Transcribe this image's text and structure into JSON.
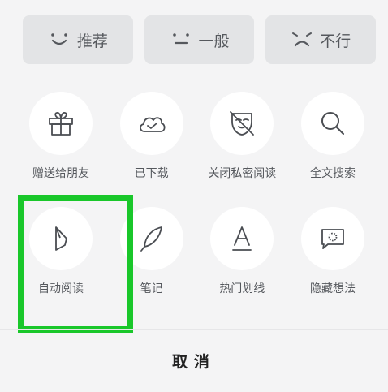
{
  "rating": {
    "items": [
      {
        "label": "推荐",
        "icon": "smile-face-icon"
      },
      {
        "label": "一般",
        "icon": "neutral-face-icon"
      },
      {
        "label": "不行",
        "icon": "frown-face-icon"
      }
    ]
  },
  "actions": {
    "row1": [
      {
        "label": "赠送给朋友",
        "icon": "gift-icon"
      },
      {
        "label": "已下载",
        "icon": "cloud-check-icon"
      },
      {
        "label": "关闭私密阅读",
        "icon": "mask-off-icon"
      },
      {
        "label": "全文搜索",
        "icon": "search-icon"
      }
    ],
    "row2": [
      {
        "label": "自动阅读",
        "icon": "auto-read-icon"
      },
      {
        "label": "笔记",
        "icon": "feather-icon"
      },
      {
        "label": "热门划线",
        "icon": "underline-a-icon"
      },
      {
        "label": "隐藏想法",
        "icon": "thought-bubble-icon"
      }
    ]
  },
  "footer": {
    "cancel_label": "取消"
  },
  "colors": {
    "highlight": "#19c72a",
    "icon": "#4a4d52",
    "panel_bg": "#f4f4f5",
    "rating_bg": "#e3e4e6"
  }
}
